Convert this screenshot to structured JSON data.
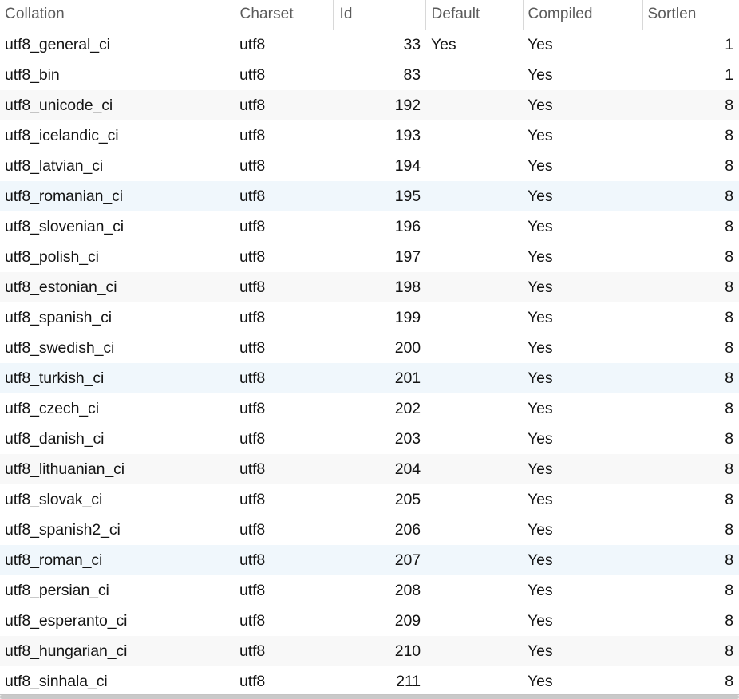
{
  "table": {
    "name": "mysql-collation-list",
    "columns": [
      {
        "key": "collation",
        "label": "Collation",
        "align": "left"
      },
      {
        "key": "charset",
        "label": "Charset",
        "align": "left"
      },
      {
        "key": "id",
        "label": "Id",
        "align": "right"
      },
      {
        "key": "default",
        "label": "Default",
        "align": "left"
      },
      {
        "key": "compiled",
        "label": "Compiled",
        "align": "left"
      },
      {
        "key": "sortlen",
        "label": "Sortlen",
        "align": "right"
      }
    ],
    "rows": [
      {
        "collation": "utf8_general_ci",
        "charset": "utf8",
        "id": "33",
        "default": "Yes",
        "compiled": "Yes",
        "sortlen": "1",
        "stripe": "none"
      },
      {
        "collation": "utf8_bin",
        "charset": "utf8",
        "id": "83",
        "default": "",
        "compiled": "Yes",
        "sortlen": "1",
        "stripe": "none"
      },
      {
        "collation": "utf8_unicode_ci",
        "charset": "utf8",
        "id": "192",
        "default": "",
        "compiled": "Yes",
        "sortlen": "8",
        "stripe": "gray"
      },
      {
        "collation": "utf8_icelandic_ci",
        "charset": "utf8",
        "id": "193",
        "default": "",
        "compiled": "Yes",
        "sortlen": "8",
        "stripe": "none"
      },
      {
        "collation": "utf8_latvian_ci",
        "charset": "utf8",
        "id": "194",
        "default": "",
        "compiled": "Yes",
        "sortlen": "8",
        "stripe": "none"
      },
      {
        "collation": "utf8_romanian_ci",
        "charset": "utf8",
        "id": "195",
        "default": "",
        "compiled": "Yes",
        "sortlen": "8",
        "stripe": "blue"
      },
      {
        "collation": "utf8_slovenian_ci",
        "charset": "utf8",
        "id": "196",
        "default": "",
        "compiled": "Yes",
        "sortlen": "8",
        "stripe": "none"
      },
      {
        "collation": "utf8_polish_ci",
        "charset": "utf8",
        "id": "197",
        "default": "",
        "compiled": "Yes",
        "sortlen": "8",
        "stripe": "none"
      },
      {
        "collation": "utf8_estonian_ci",
        "charset": "utf8",
        "id": "198",
        "default": "",
        "compiled": "Yes",
        "sortlen": "8",
        "stripe": "gray"
      },
      {
        "collation": "utf8_spanish_ci",
        "charset": "utf8",
        "id": "199",
        "default": "",
        "compiled": "Yes",
        "sortlen": "8",
        "stripe": "none"
      },
      {
        "collation": "utf8_swedish_ci",
        "charset": "utf8",
        "id": "200",
        "default": "",
        "compiled": "Yes",
        "sortlen": "8",
        "stripe": "none"
      },
      {
        "collation": "utf8_turkish_ci",
        "charset": "utf8",
        "id": "201",
        "default": "",
        "compiled": "Yes",
        "sortlen": "8",
        "stripe": "blue"
      },
      {
        "collation": "utf8_czech_ci",
        "charset": "utf8",
        "id": "202",
        "default": "",
        "compiled": "Yes",
        "sortlen": "8",
        "stripe": "none"
      },
      {
        "collation": "utf8_danish_ci",
        "charset": "utf8",
        "id": "203",
        "default": "",
        "compiled": "Yes",
        "sortlen": "8",
        "stripe": "none"
      },
      {
        "collation": "utf8_lithuanian_ci",
        "charset": "utf8",
        "id": "204",
        "default": "",
        "compiled": "Yes",
        "sortlen": "8",
        "stripe": "gray"
      },
      {
        "collation": "utf8_slovak_ci",
        "charset": "utf8",
        "id": "205",
        "default": "",
        "compiled": "Yes",
        "sortlen": "8",
        "stripe": "none"
      },
      {
        "collation": "utf8_spanish2_ci",
        "charset": "utf8",
        "id": "206",
        "default": "",
        "compiled": "Yes",
        "sortlen": "8",
        "stripe": "none"
      },
      {
        "collation": "utf8_roman_ci",
        "charset": "utf8",
        "id": "207",
        "default": "",
        "compiled": "Yes",
        "sortlen": "8",
        "stripe": "blue"
      },
      {
        "collation": "utf8_persian_ci",
        "charset": "utf8",
        "id": "208",
        "default": "",
        "compiled": "Yes",
        "sortlen": "8",
        "stripe": "none"
      },
      {
        "collation": "utf8_esperanto_ci",
        "charset": "utf8",
        "id": "209",
        "default": "",
        "compiled": "Yes",
        "sortlen": "8",
        "stripe": "none"
      },
      {
        "collation": "utf8_hungarian_ci",
        "charset": "utf8",
        "id": "210",
        "default": "",
        "compiled": "Yes",
        "sortlen": "8",
        "stripe": "gray"
      },
      {
        "collation": "utf8_sinhala_ci",
        "charset": "utf8",
        "id": "211",
        "default": "",
        "compiled": "Yes",
        "sortlen": "8",
        "stripe": "none"
      }
    ]
  },
  "colors": {
    "background": "#ffffff",
    "header_text": "#5b5b5b",
    "body_text": "#141414",
    "header_rule": "#c9c9c9",
    "column_divider": "#d8d8d8",
    "stripe_gray": "#f8f8f8",
    "stripe_blue": "#f0f7fc",
    "scrollbar_track": "#f1f1f1",
    "scrollbar_thumb": "#c9c9c9"
  },
  "scrollbar": {
    "orientation": "horizontal",
    "position": "bottom"
  }
}
